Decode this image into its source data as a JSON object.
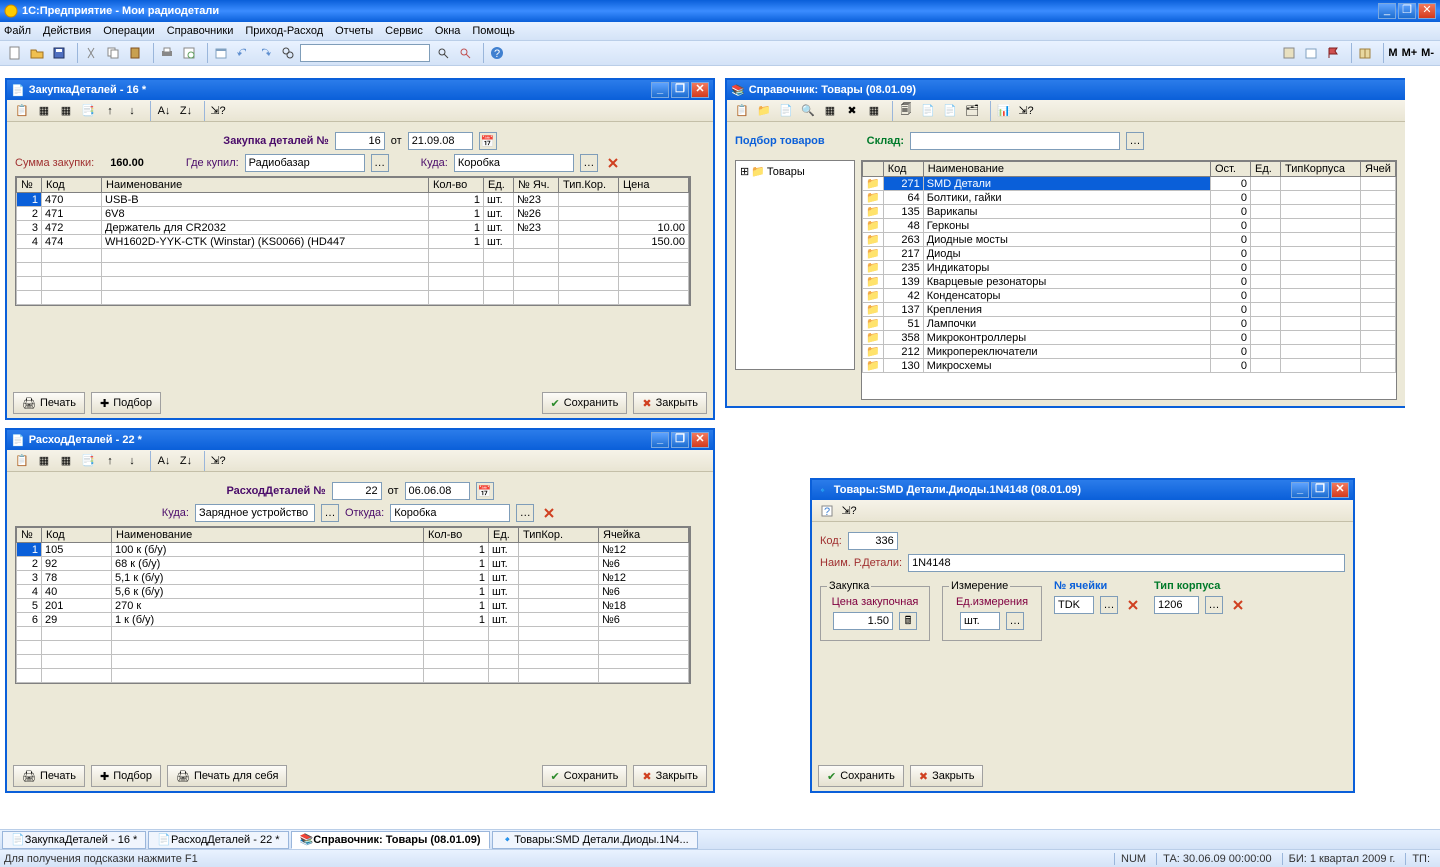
{
  "app": {
    "title": "1С:Предприятие - Мои радиодетали",
    "menu": [
      "Файл",
      "Действия",
      "Операции",
      "Справочники",
      "Приход-Расход",
      "Отчеты",
      "Сервис",
      "Окна",
      "Помощь"
    ],
    "m_labels": {
      "m": "M",
      "mp": "M+",
      "mm": "M-"
    }
  },
  "win_purchase": {
    "title": "ЗакупкаДеталей - 16 *",
    "label_num": "Закупка деталей №",
    "num": "16",
    "label_ot": "от",
    "date": "21.09.08",
    "sum_label": "Сумма закупки:",
    "sum_val": "160.00",
    "where_label": "Где купил:",
    "where_val": "Радиобазар",
    "to_label": "Куда:",
    "to_val": "Коробка",
    "cols": [
      "№",
      "Код",
      "Наименование",
      "Кол-во",
      "Ед.",
      "№ Яч.",
      "Тип.Кор.",
      "Цена"
    ],
    "rows": [
      {
        "n": "1",
        "kod": "470",
        "name": "USB-B",
        "qty": "1",
        "ed": "шт.",
        "cell": "№23",
        "tk": "",
        "price": ""
      },
      {
        "n": "2",
        "kod": "471",
        "name": "6V8",
        "qty": "1",
        "ed": "шт.",
        "cell": "№26",
        "tk": "",
        "price": ""
      },
      {
        "n": "3",
        "kod": "472",
        "name": "Держатель для CR2032",
        "qty": "1",
        "ed": "шт.",
        "cell": "№23",
        "tk": "",
        "price": "10.00"
      },
      {
        "n": "4",
        "kod": "474",
        "name": "WH1602D-YYK-CTK (Winstar) (KS0066) (HD447",
        "qty": "1",
        "ed": "шт.",
        "cell": "",
        "tk": "",
        "price": "150.00"
      }
    ],
    "btn_print": "Печать",
    "btn_pick": "Подбор",
    "btn_save": "Сохранить",
    "btn_close": "Закрыть"
  },
  "win_expense": {
    "title": "РасходДеталей - 22 *",
    "label_num": "РасходДеталей №",
    "num": "22",
    "label_ot": "от",
    "date": "06.06.08",
    "to_label": "Куда:",
    "to_val": "Зарядное устройство",
    "from_label": "Откуда:",
    "from_val": "Коробка",
    "cols": [
      "№",
      "Код",
      "Наименование",
      "Кол-во",
      "Ед.",
      "ТипКор.",
      "Ячейка"
    ],
    "rows": [
      {
        "n": "1",
        "kod": "105",
        "name": "100 к (б/у)",
        "qty": "1",
        "ed": "шт.",
        "tk": "",
        "cell": "№12"
      },
      {
        "n": "2",
        "kod": "92",
        "name": "68 к (б/у)",
        "qty": "1",
        "ed": "шт.",
        "tk": "",
        "cell": "№6"
      },
      {
        "n": "3",
        "kod": "78",
        "name": "5,1 к (б/у)",
        "qty": "1",
        "ed": "шт.",
        "tk": "",
        "cell": "№12"
      },
      {
        "n": "4",
        "kod": "40",
        "name": "5,6 к (б/у)",
        "qty": "1",
        "ed": "шт.",
        "tk": "",
        "cell": "№6"
      },
      {
        "n": "5",
        "kod": "201",
        "name": "270 к",
        "qty": "1",
        "ed": "шт.",
        "tk": "",
        "cell": "№18"
      },
      {
        "n": "6",
        "kod": "29",
        "name": "1 к (б/у)",
        "qty": "1",
        "ed": "шт.",
        "tk": "",
        "cell": "№6"
      }
    ],
    "btn_print": "Печать",
    "btn_pick": "Подбор",
    "btn_print2": "Печать для себя",
    "btn_save": "Сохранить",
    "btn_close": "Закрыть"
  },
  "win_ref": {
    "title": "Справочник: Товары (08.01.09)",
    "pick_label": "Подбор товаров",
    "stock_label": "Склад:",
    "tree_root": "Товары",
    "cols": [
      "",
      "Код",
      "Наименование",
      "Ост.",
      "Ед.",
      "ТипКорпуса",
      "Ячей"
    ],
    "rows": [
      {
        "kod": "271",
        "name": "SMD Детали",
        "ost": "0",
        "sel": true
      },
      {
        "kod": "64",
        "name": "Болтики, гайки",
        "ost": "0"
      },
      {
        "kod": "135",
        "name": "Варикапы",
        "ost": "0"
      },
      {
        "kod": "48",
        "name": "Герконы",
        "ost": "0"
      },
      {
        "kod": "263",
        "name": "Диодные мосты",
        "ost": "0"
      },
      {
        "kod": "217",
        "name": "Диоды",
        "ost": "0"
      },
      {
        "kod": "235",
        "name": "Индикаторы",
        "ost": "0"
      },
      {
        "kod": "139",
        "name": "Кварцевые резонаторы",
        "ost": "0"
      },
      {
        "kod": "42",
        "name": "Конденсаторы",
        "ost": "0"
      },
      {
        "kod": "137",
        "name": "Крепления",
        "ost": "0"
      },
      {
        "kod": "51",
        "name": "Лампочки",
        "ost": "0"
      },
      {
        "kod": "358",
        "name": "Микроконтроллеры",
        "ost": "0"
      },
      {
        "kod": "212",
        "name": "Микропереключатели",
        "ost": "0"
      },
      {
        "kod": "130",
        "name": "Микросхемы",
        "ost": "0"
      }
    ]
  },
  "win_item": {
    "title": "Товары:SMD Детали.Диоды.1N4148 (08.01.09)",
    "kod_label": "Код:",
    "kod": "336",
    "name_label": "Наим. Р.Детали:",
    "name": "1N4148",
    "fs_purchase": "Закупка",
    "price_label": "Цена закупочная",
    "price": "1.50",
    "fs_measure": "Измерение",
    "measure_label": "Ед.измерения",
    "measure": "шт.",
    "cell_label": "№ ячейки",
    "cell": "TDK",
    "body_label": "Тип корпуса",
    "body": "1206",
    "btn_save": "Сохранить",
    "btn_close": "Закрыть"
  },
  "tabs": [
    {
      "label": "ЗакупкаДеталей - 16 *",
      "icon": "doc"
    },
    {
      "label": "РасходДеталей - 22 *",
      "icon": "doc"
    },
    {
      "label": "Справочник: Товары (08.01.09)",
      "icon": "book",
      "active": true
    },
    {
      "label": "Товары:SMD Детали.Диоды.1N4...",
      "icon": "item"
    }
  ],
  "status": {
    "hint": "Для получения подсказки нажмите F1",
    "num": "NUM",
    "ta": "ТА: 30.06.09 00:00:00",
    "bi": "БИ: 1 квартал 2009 г.",
    "tp": "ТП:"
  }
}
